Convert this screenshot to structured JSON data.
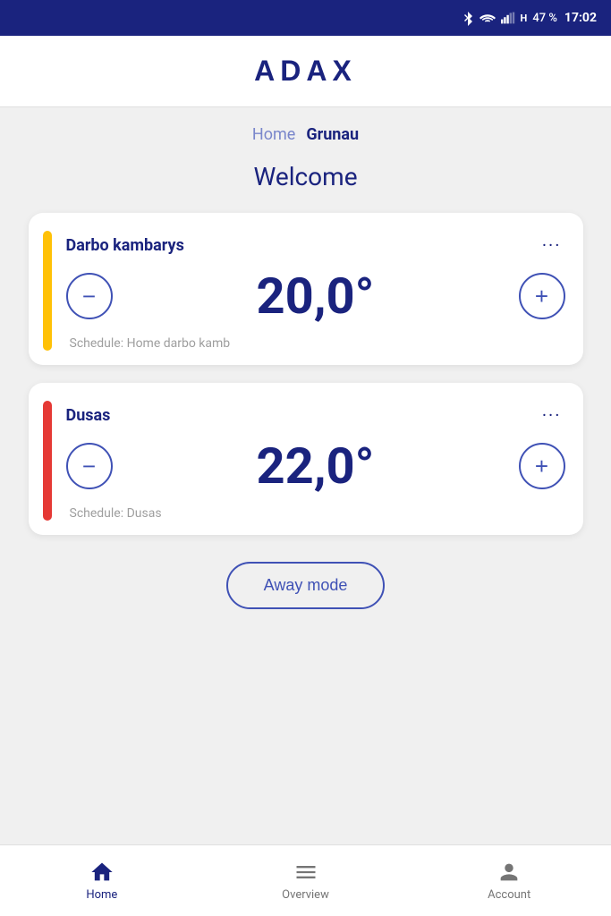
{
  "statusBar": {
    "battery": "47 %",
    "time": "17:02"
  },
  "header": {
    "logo": "ADAX"
  },
  "breadcrumb": {
    "home": "Home",
    "current": "Grunau"
  },
  "welcome": "Welcome",
  "devices": [
    {
      "id": "darbo-kambarys",
      "name": "Darbo kambarys",
      "temperature": "20,0°",
      "schedule": "Schedule: Home darbo kamb",
      "accent": "yellow",
      "menuLabel": "..."
    },
    {
      "id": "dusas",
      "name": "Dusas",
      "temperature": "22,0°",
      "schedule": "Schedule: Dusas",
      "accent": "red",
      "menuLabel": "..."
    }
  ],
  "awayModeButton": "Away mode",
  "bottomNav": {
    "home": "Home",
    "overview": "Overview",
    "account": "Account"
  },
  "buttons": {
    "minus": "−",
    "plus": "+"
  }
}
